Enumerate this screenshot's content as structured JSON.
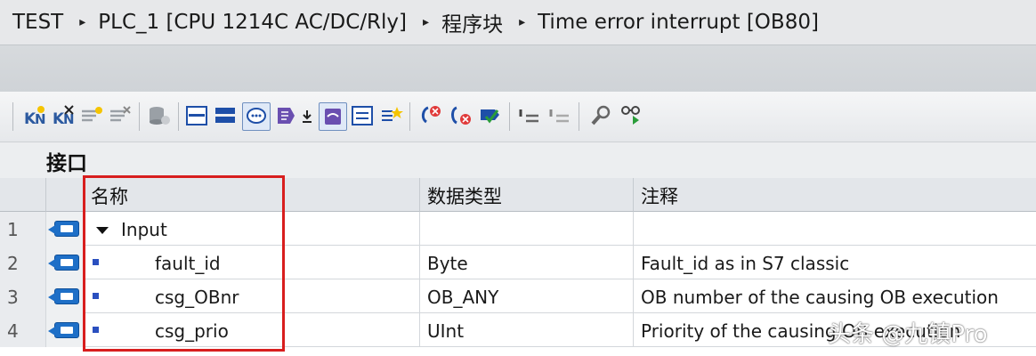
{
  "breadcrumb": {
    "items": [
      "TEST",
      "PLC_1 [CPU 1214C AC/DC/Rly]",
      "程序块",
      "Time error interrupt [OB80]"
    ],
    "separator": "▸"
  },
  "toolbar": {
    "icons": [
      "insert-row-icon",
      "delete-row-icon",
      "insert-network-icon",
      "delete-network-icon",
      "database-icon",
      "collapse-all-icon",
      "expand-all-icon",
      "comment-icon",
      "favorites-icon",
      "watch-icon",
      "list-icon",
      "star-icon",
      "call-error-icon",
      "go-back-icon",
      "compile-check-icon",
      "indent-icon",
      "outdent-icon",
      "find-icon",
      "monitor-icon"
    ]
  },
  "section": {
    "title": "接口"
  },
  "table": {
    "headers": {
      "name": "名称",
      "data_type": "数据类型",
      "comment": "注释"
    },
    "rows": [
      {
        "num": "1",
        "name": "Input",
        "type": "",
        "comment": ""
      },
      {
        "num": "2",
        "name": "fault_id",
        "type": "Byte",
        "comment": "Fault_id as in S7 classic"
      },
      {
        "num": "3",
        "name": "csg_OBnr",
        "type": "OB_ANY",
        "comment": "OB number of the causing OB execution"
      },
      {
        "num": "4",
        "name": "csg_prio",
        "type": "UInt",
        "comment": "Priority of the causing OB execution"
      }
    ]
  },
  "watermark": "头条 @九镇Pro",
  "colors": {
    "highlight_box": "#d81e1e",
    "accent": "#1e6fc7"
  }
}
